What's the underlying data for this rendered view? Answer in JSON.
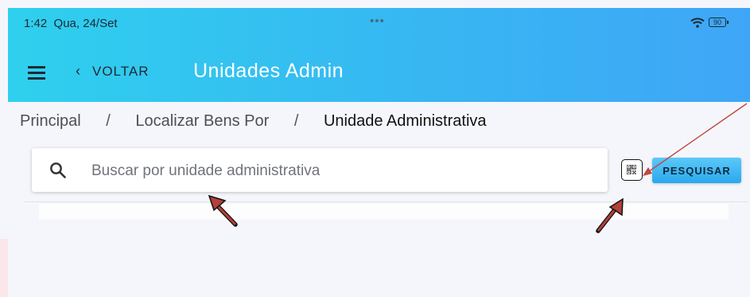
{
  "status_bar": {
    "time": "1:42",
    "date": "Qua, 24/Set",
    "dots": "•••",
    "battery": "90"
  },
  "app_bar": {
    "back_label": "VOLTAR",
    "title": "Unidades Admin"
  },
  "breadcrumb": {
    "items": [
      "Principal",
      "Localizar Bens Por",
      "Unidade Administrativa"
    ],
    "separator": "/"
  },
  "search": {
    "placeholder": "Buscar por unidade administrativa",
    "value": "",
    "button_label": "PESQUISAR"
  },
  "icons": {
    "menu": "menu-icon",
    "back": "chevron-left-icon",
    "search": "search-icon",
    "qr": "qr-code-icon",
    "wifi": "wifi-icon",
    "battery": "battery-icon"
  },
  "colors": {
    "appbar_start": "#2fd0ee",
    "appbar_end": "#3fa6f7",
    "title": "#ffffff",
    "annotation_arrow": "#b3403a"
  }
}
